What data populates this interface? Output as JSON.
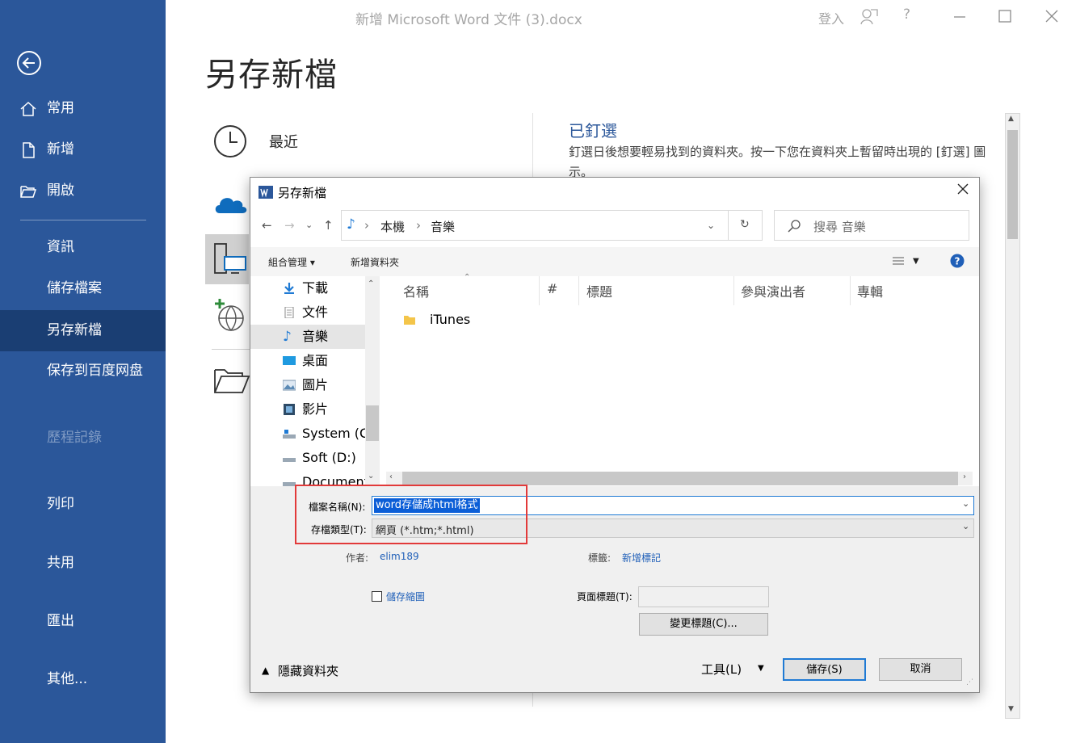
{
  "window": {
    "title": "新增 Microsoft Word 文件 (3).docx",
    "signin": "登入",
    "help": "?"
  },
  "sidebar": {
    "items": [
      {
        "label": "常用"
      },
      {
        "label": "新增"
      },
      {
        "label": "開啟"
      },
      {
        "label": "資訊"
      },
      {
        "label": "儲存檔案"
      },
      {
        "label": "另存新檔"
      },
      {
        "label": "保存到百度网盘"
      },
      {
        "label": "歷程記錄"
      },
      {
        "label": "列印"
      },
      {
        "label": "共用"
      },
      {
        "label": "匯出"
      },
      {
        "label": "其他..."
      }
    ]
  },
  "backstage": {
    "title": "另存新檔",
    "locations": [
      {
        "label": "最近"
      }
    ],
    "pinned_title": "已釘選",
    "pinned_desc": "釘選日後想要輕易找到的資料夾。按一下您在資料夾上暫留時出現的 [釘選] 圖示。"
  },
  "dialog": {
    "title": "另存新檔",
    "path": [
      "本機",
      "音樂"
    ],
    "search_placeholder": "搜尋 音樂",
    "organize": "組合管理 ▾",
    "new_folder": "新增資料夾",
    "tree": [
      {
        "label": "下載"
      },
      {
        "label": "文件"
      },
      {
        "label": "音樂"
      },
      {
        "label": "桌面"
      },
      {
        "label": "圖片"
      },
      {
        "label": "影片"
      },
      {
        "label": "System (C:)"
      },
      {
        "label": "Soft (D:)"
      },
      {
        "label": "Documents"
      }
    ],
    "columns": [
      "名稱",
      "#",
      "標題",
      "參與演出者",
      "專輯"
    ],
    "files": [
      {
        "name": "iTunes"
      }
    ],
    "filename_label": "檔案名稱(N):",
    "filename_value": "word存儲成html格式",
    "filetype_label": "存檔類型(T):",
    "filetype_value": "網頁 (*.htm;*.html)",
    "author_label": "作者:",
    "author_value": "elim189",
    "tags_label": "標籤:",
    "tags_value": "新增標記",
    "thumbnail_label": "儲存縮圖",
    "page_title_label": "頁面標題(T):",
    "change_title_button": "變更標題(C)...",
    "hide_folders": "隱藏資料夾",
    "tools": "工具(L)",
    "save_button": "儲存(S)",
    "cancel_button": "取消"
  }
}
